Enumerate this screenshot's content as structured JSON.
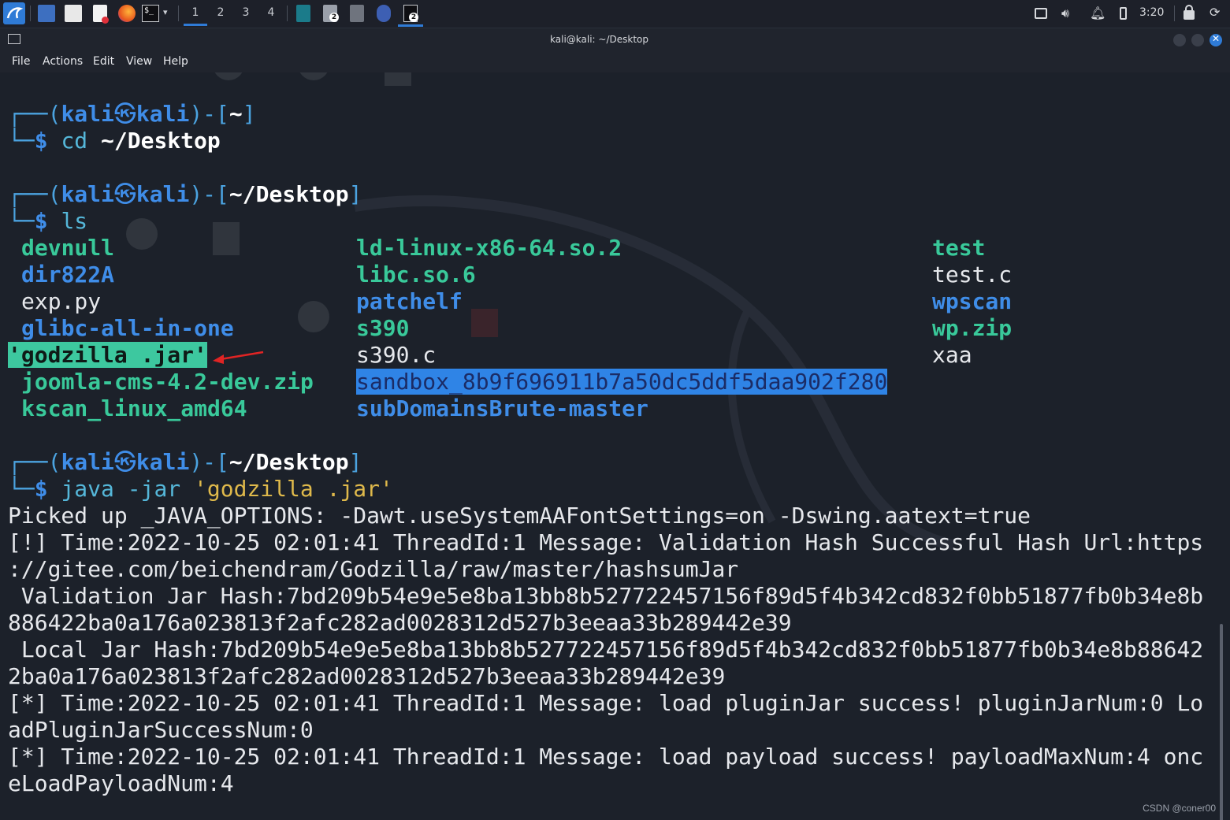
{
  "taskbar": {
    "workspaces": [
      "1",
      "2",
      "3",
      "4"
    ],
    "active_workspace": "1",
    "badges": [
      "2",
      "2"
    ],
    "clock": "3:20",
    "icons": [
      "kali-menu-icon",
      "show-desktop-icon",
      "file-manager-icon",
      "text-editor-icon",
      "firefox-icon",
      "terminal-icon",
      "chevron-down-icon",
      "app-icon-1",
      "app-icon-2",
      "app-icon-3",
      "app-icon-4",
      "terminal-app-icon",
      "notes-icon",
      "volume-icon",
      "bell-icon",
      "battery-icon",
      "lock-icon",
      "power-icon"
    ]
  },
  "window": {
    "title": "kali@kali: ~/Desktop",
    "menu": [
      "File",
      "Actions",
      "Edit",
      "View",
      "Help"
    ]
  },
  "prompt": {
    "user": "kali",
    "host": "kali",
    "at_symbol": "㉿",
    "tree_top": "┌──",
    "tree_bottom": "└─",
    "dollar": "$"
  },
  "blocks": [
    {
      "path": "~",
      "command": "cd",
      "argument": "~/Desktop"
    },
    {
      "path": "~/Desktop",
      "command": "ls",
      "argument": ""
    },
    {
      "path": "~/Desktop",
      "command": "java -jar",
      "argument": "'godzilla .jar'"
    }
  ],
  "ls_output": {
    "col1": [
      {
        "name": "devnull",
        "style": "green"
      },
      {
        "name": "dir822A",
        "style": "blue"
      },
      {
        "name": "exp.py",
        "style": "plain"
      },
      {
        "name": "glibc-all-in-one",
        "style": "blue"
      },
      {
        "name": "'godzilla .jar'",
        "style": "hl-green"
      },
      {
        "name": "joomla-cms-4.2-dev.zip",
        "style": "green"
      },
      {
        "name": "kscan_linux_amd64",
        "style": "green"
      }
    ],
    "col2": [
      {
        "name": "ld-linux-x86-64.so.2",
        "style": "green"
      },
      {
        "name": "libc.so.6",
        "style": "green"
      },
      {
        "name": "patchelf",
        "style": "blue"
      },
      {
        "name": "s390",
        "style": "green"
      },
      {
        "name": "s390.c",
        "style": "plain"
      },
      {
        "name": "sandbox_8b9f696911b7a50dc5ddf5daa902f280",
        "style": "hl-blue"
      },
      {
        "name": "subDomainsBrute-master",
        "style": "blue"
      }
    ],
    "col3": [
      {
        "name": "test",
        "style": "green"
      },
      {
        "name": "test.c",
        "style": "plain"
      },
      {
        "name": "wpscan",
        "style": "blue"
      },
      {
        "name": "wp.zip",
        "style": "green"
      },
      {
        "name": "xaa",
        "style": "plain"
      }
    ]
  },
  "output_lines": [
    "Picked up _JAVA_OPTIONS: -Dawt.useSystemAAFontSettings=on -Dswing.aatext=true",
    "[!] Time:2022-10-25 02:01:41 ThreadId:1 Message: Validation Hash Successful Hash Url:https",
    "://gitee.com/beichendram/Godzilla/raw/master/hashsumJar",
    " Validation Jar Hash:7bd209b54e9e5e8ba13bb8b527722457156f89d5f4b342cd832f0bb51877fb0b34e8b",
    "886422ba0a176a023813f2afc282ad0028312d527b3eeaa33b289442e39",
    " Local Jar Hash:7bd209b54e9e5e8ba13bb8b527722457156f89d5f4b342cd832f0bb51877fb0b34e8b88642",
    "2ba0a176a023813f2afc282ad0028312d527b3eeaa33b289442e39",
    "[*] Time:2022-10-25 02:01:41 ThreadId:1 Message: load pluginJar success! pluginJarNum:0 Lo",
    "adPluginJarSuccessNum:0",
    "[*] Time:2022-10-25 02:01:41 ThreadId:1 Message: load payload success! payloadMaxNum:4 onc",
    "eLoadPayloadNum:4"
  ],
  "annotation": {
    "color": "#e02424"
  },
  "watermark": "CSDN @coner00",
  "colors": {
    "blue": "#3f8de8",
    "green": "#39c99a",
    "highlight_green": "#3dc89f",
    "highlight_blue": "#2f84e6",
    "background": "#1c212a"
  }
}
